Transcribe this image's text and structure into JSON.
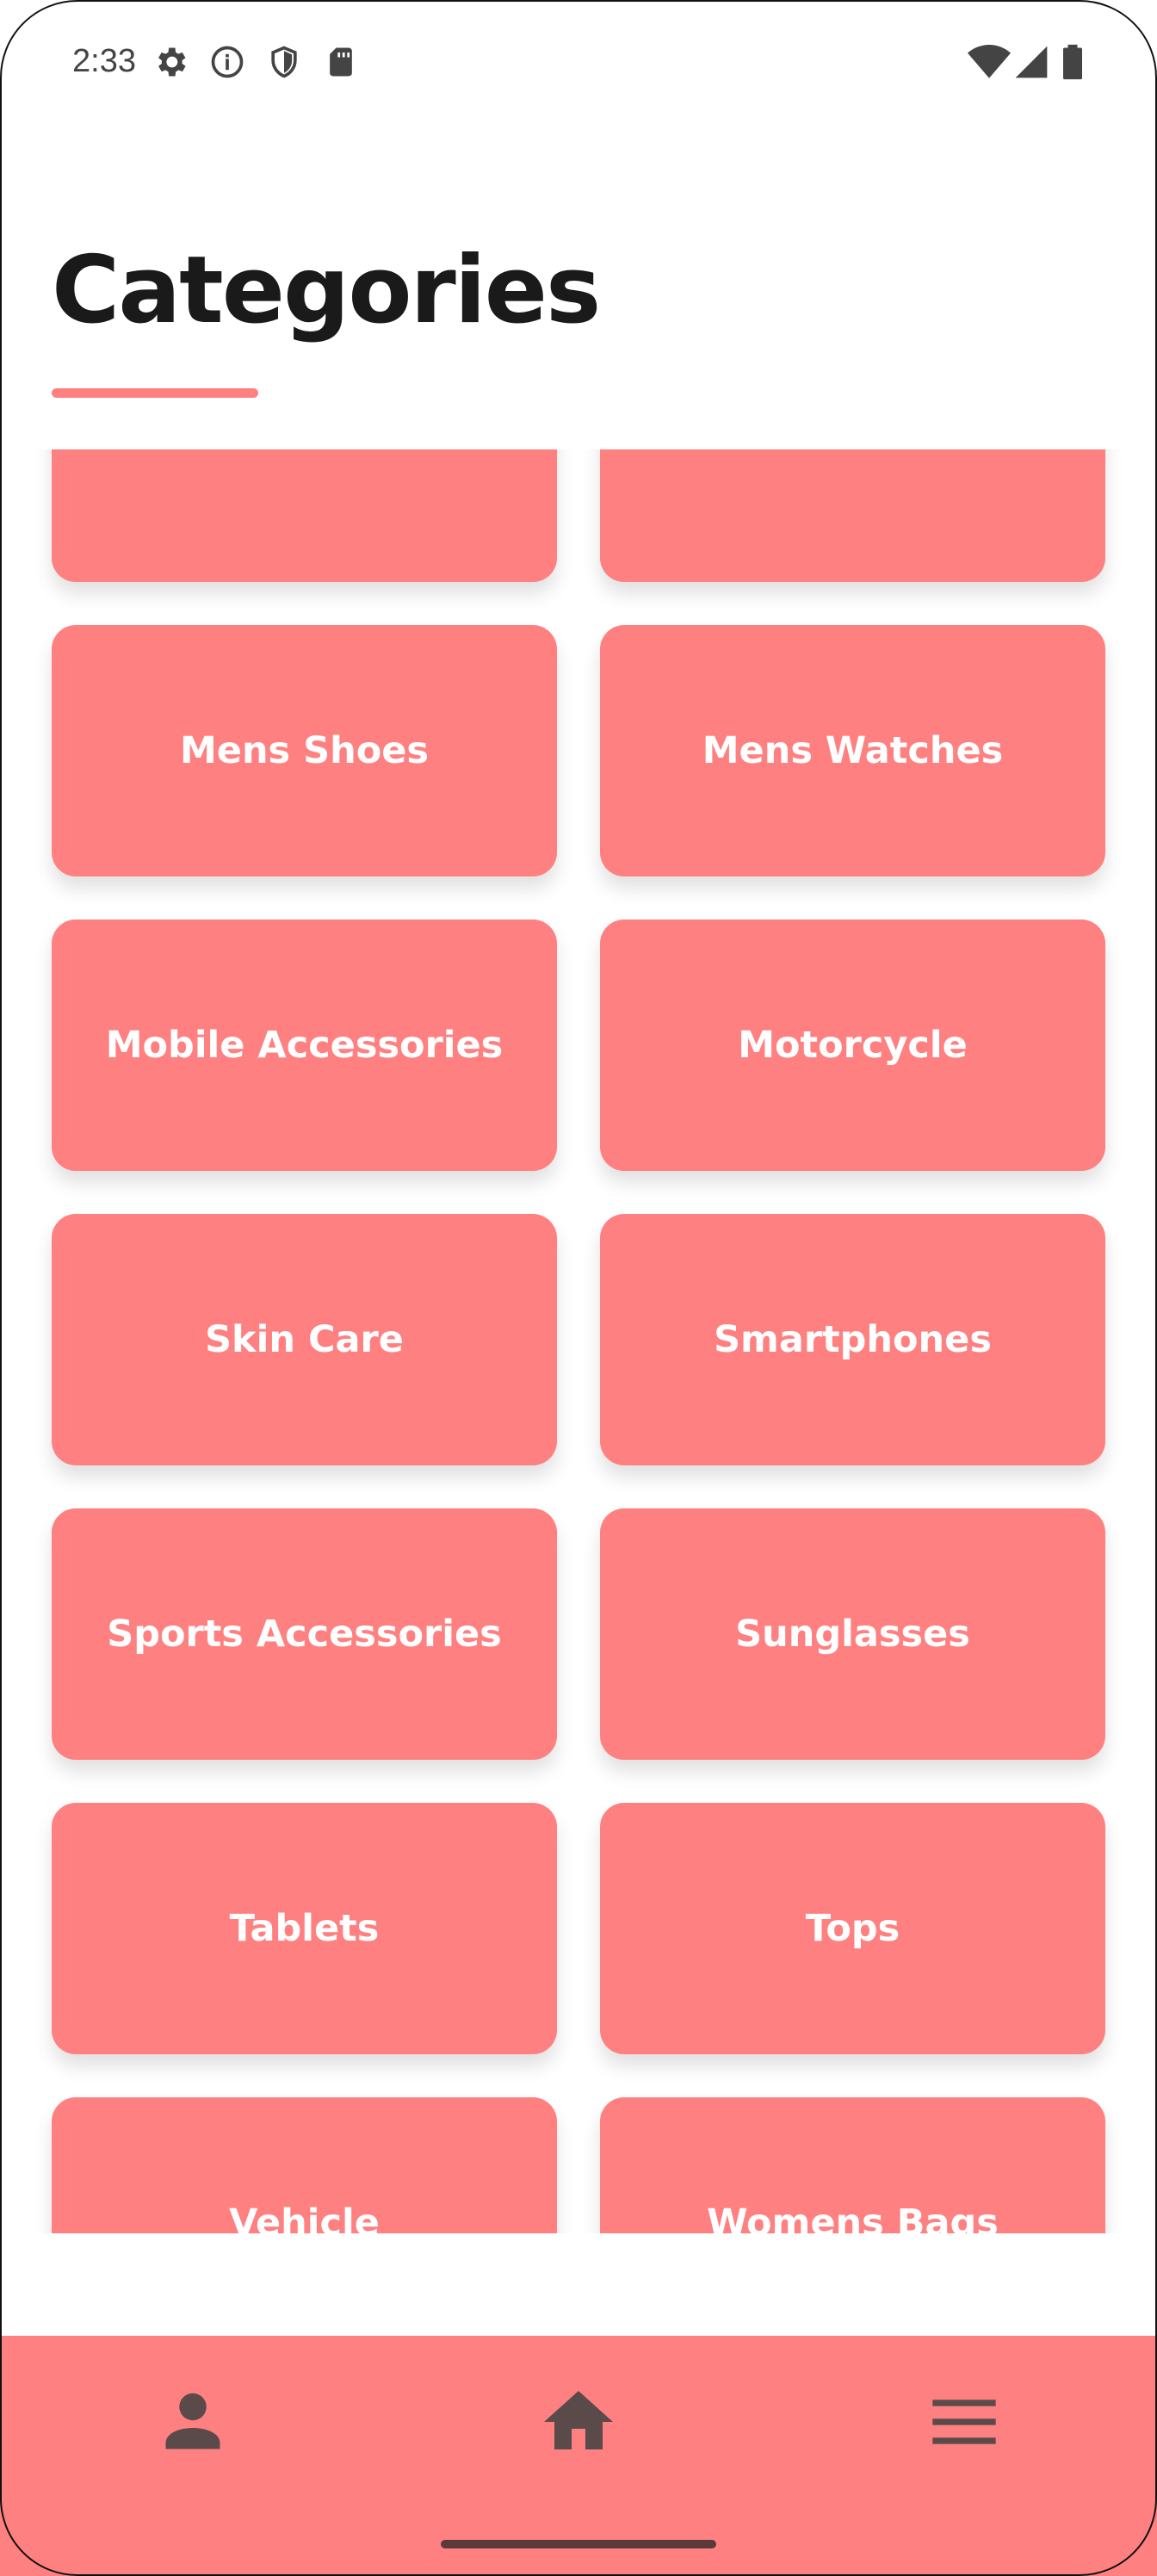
{
  "status_bar": {
    "time": "2:33",
    "left_icons": [
      "gear-icon",
      "info-icon",
      "shield-icon",
      "sd-card-icon"
    ],
    "right_icons": [
      "wifi-icon",
      "signal-icon",
      "battery-icon"
    ]
  },
  "page": {
    "title": "Categories",
    "accent_color": "#ff8080"
  },
  "categories": [
    {
      "label": ""
    },
    {
      "label": ""
    },
    {
      "label": "Mens Shoes"
    },
    {
      "label": "Mens Watches"
    },
    {
      "label": "Mobile Accessories"
    },
    {
      "label": "Motorcycle"
    },
    {
      "label": "Skin Care"
    },
    {
      "label": "Smartphones"
    },
    {
      "label": "Sports Accessories"
    },
    {
      "label": "Sunglasses"
    },
    {
      "label": "Tablets"
    },
    {
      "label": "Tops"
    },
    {
      "label": "Vehicle"
    },
    {
      "label": "Womens Bags"
    }
  ],
  "bottom_nav": {
    "items": [
      {
        "icon": "person-icon"
      },
      {
        "icon": "home-icon"
      },
      {
        "icon": "menu-icon"
      }
    ]
  }
}
